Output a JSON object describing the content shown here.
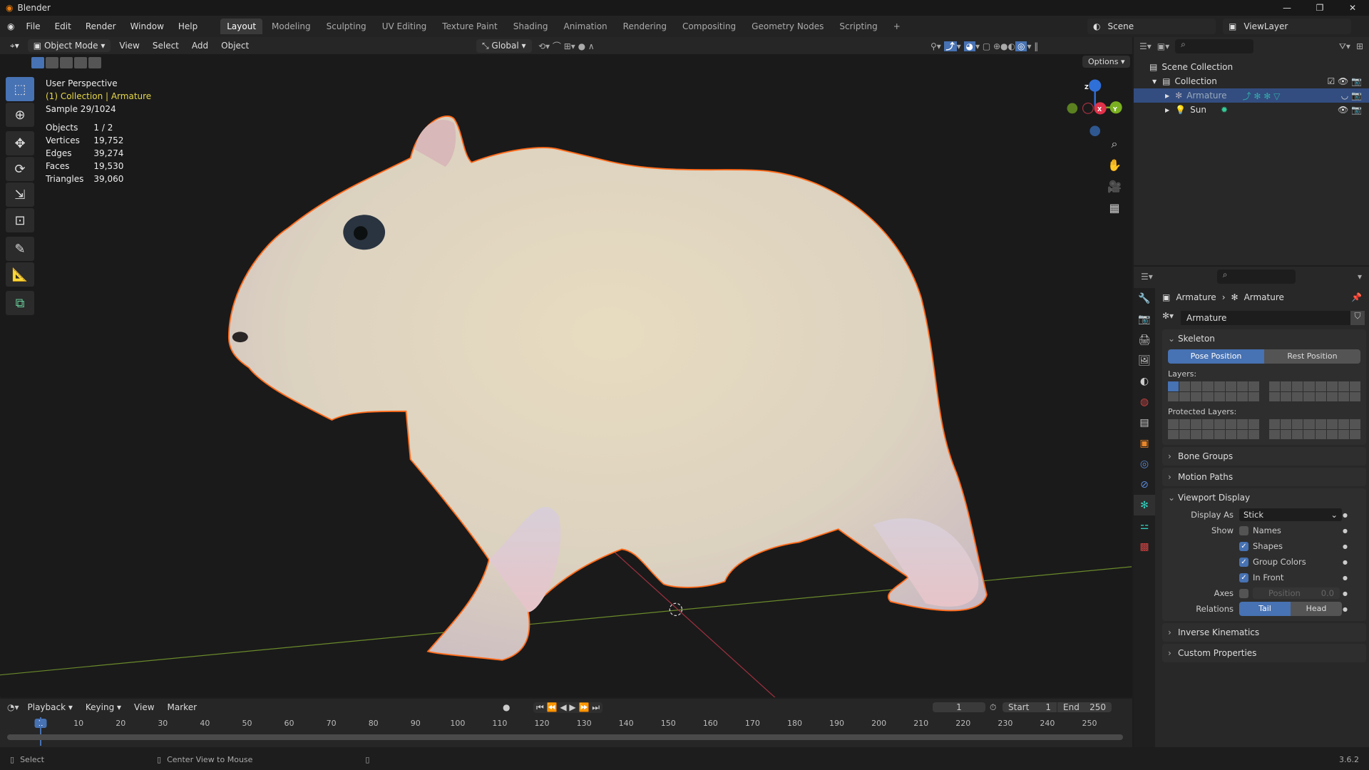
{
  "title": "Blender",
  "menu": [
    "File",
    "Edit",
    "Render",
    "Window",
    "Help"
  ],
  "workspaces": [
    "Layout",
    "Modeling",
    "Sculpting",
    "UV Editing",
    "Texture Paint",
    "Shading",
    "Animation",
    "Rendering",
    "Compositing",
    "Geometry Nodes",
    "Scripting",
    "+"
  ],
  "scene": "Scene",
  "view_layer": "ViewLayer",
  "viewport": {
    "mode": "Object Mode",
    "menus": [
      "View",
      "Select",
      "Add",
      "Object"
    ],
    "orientation": "Global",
    "options": "Options",
    "overlay": {
      "perspective": "User Perspective",
      "collection": "(1) Collection | Armature",
      "sample": "Sample 29/1024"
    },
    "stats": [
      {
        "k": "Objects",
        "v": "1 / 2"
      },
      {
        "k": "Vertices",
        "v": "19,752"
      },
      {
        "k": "Edges",
        "v": "39,274"
      },
      {
        "k": "Faces",
        "v": "19,530"
      },
      {
        "k": "Triangles",
        "v": "39,060"
      }
    ],
    "gizmo": {
      "z": "Z",
      "x": "X",
      "y": "Y"
    }
  },
  "outliner": {
    "items": [
      {
        "label": "Scene Collection"
      },
      {
        "label": "Collection"
      },
      {
        "label": "Armature"
      },
      {
        "label": "Sun"
      }
    ]
  },
  "properties": {
    "breadcrumb": [
      "Armature",
      "Armature"
    ],
    "data_name": "Armature",
    "skeleton": {
      "title": "Skeleton",
      "pose": "Pose Position",
      "rest": "Rest Position",
      "layers": "Layers:",
      "protected": "Protected Layers:"
    },
    "collapsed": [
      "Bone Groups",
      "Motion Paths"
    ],
    "viewport_display": {
      "title": "Viewport Display",
      "display_as_label": "Display As",
      "display_as": "Stick",
      "show_label": "Show",
      "checks": [
        {
          "label": "Names",
          "on": false
        },
        {
          "label": "Shapes",
          "on": true
        },
        {
          "label": "Group Colors",
          "on": true
        },
        {
          "label": "In Front",
          "on": true
        }
      ],
      "axes_label": "Axes",
      "axes_pos": "Position",
      "axes_val": "0.0",
      "relations_label": "Relations",
      "tail": "Tail",
      "head": "Head"
    },
    "collapsed2": [
      "Inverse Kinematics",
      "Custom Properties"
    ]
  },
  "timeline": {
    "menus": [
      "Playback",
      "Keying",
      "View",
      "Marker"
    ],
    "current": "1",
    "start_label": "Start",
    "start": "1",
    "end_label": "End",
    "end": "250",
    "ticks": [
      "1",
      "10",
      "20",
      "30",
      "40",
      "50",
      "60",
      "70",
      "80",
      "90",
      "100",
      "110",
      "120",
      "130",
      "140",
      "150",
      "160",
      "170",
      "180",
      "190",
      "200",
      "210",
      "220",
      "230",
      "240",
      "250"
    ]
  },
  "status": {
    "select": "Select",
    "center": "Center View to Mouse",
    "version": "3.6.2"
  }
}
